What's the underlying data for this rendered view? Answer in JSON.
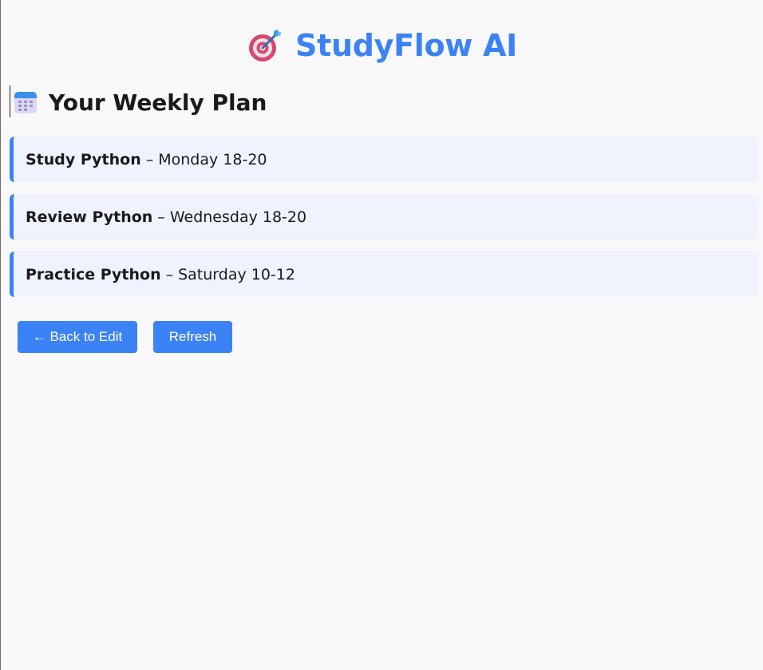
{
  "header": {
    "icon": "target-icon",
    "title": "StudyFlow AI",
    "accent_color": "#3b82f6"
  },
  "section": {
    "icon": "calendar-icon",
    "title": "Your Weekly Plan"
  },
  "plan": {
    "separator": "–",
    "items": [
      {
        "task": "Study Python",
        "schedule": "Monday 18-20"
      },
      {
        "task": "Review Python",
        "schedule": "Wednesday 18-20"
      },
      {
        "task": "Practice Python",
        "schedule": "Saturday 10-12"
      }
    ]
  },
  "actions": {
    "back_label": "← Back to Edit",
    "refresh_label": "Refresh"
  }
}
